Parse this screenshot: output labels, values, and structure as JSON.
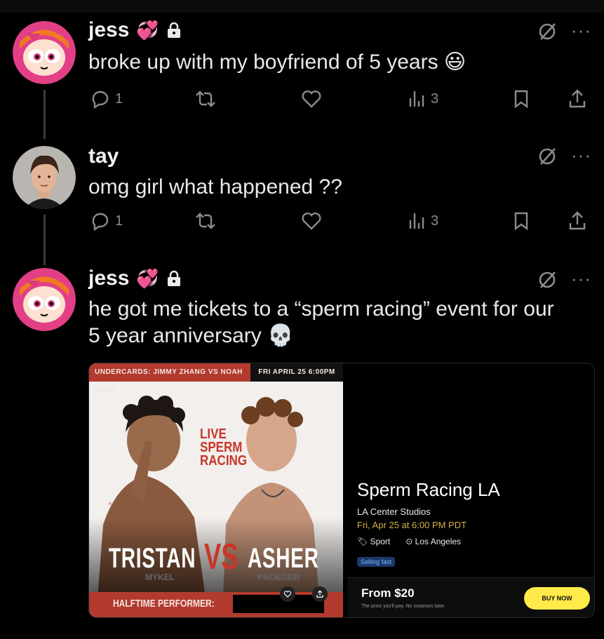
{
  "posts": [
    {
      "name": "jess",
      "name_emoji": "💞",
      "locked": true,
      "text": "broke up with my boyfriend of 5 years 😃",
      "replies": "1",
      "views": "3"
    },
    {
      "name": "tay",
      "name_emoji": "",
      "locked": false,
      "text": "omg girl what happened ??",
      "replies": "1",
      "views": "3"
    },
    {
      "name": "jess",
      "name_emoji": "💞",
      "locked": true,
      "text_line1": "he got me tickets to a “sperm racing” event for our",
      "text_line2": "5 year anniversary 💀"
    }
  ],
  "more_glyph": "···",
  "event_card": {
    "poster": {
      "undercards": "UNDERCARDS: JIMMY ZHANG VS NOAH BOAT",
      "date": "FRI APRIL 25 6:00PM",
      "live_text": "LIVE SPERM RACING",
      "left_fighter": "TRISTAN",
      "left_sub": "MYKEL",
      "vs": "VS",
      "right_fighter": "ASHER",
      "right_sub": "PROEGER",
      "halftime": "HALFTIME PERFORMER:"
    },
    "title": "Sperm Racing LA",
    "venue": "LA Center Studios",
    "when": "Fri, Apr 25 at 6:00 PM PDT",
    "category": "Sport",
    "location": "Los Angeles",
    "badge": "Selling fast",
    "price": "From $20",
    "price_note": "The price you'll pay. No surprises later.",
    "buy_label": "BUY NOW",
    "colors": {
      "accent_red": "#b23a2f",
      "buy_yellow": "#ffea4a",
      "date_gold": "#d4b14a"
    }
  }
}
